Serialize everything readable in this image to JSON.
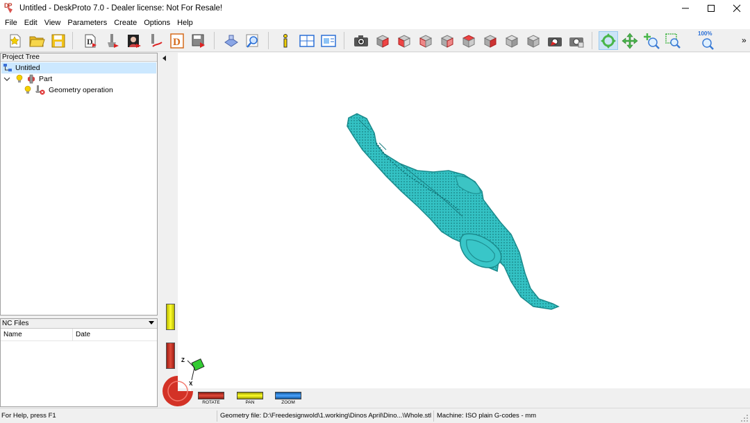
{
  "window": {
    "title": "Untitled - DeskProto 7.0 - Dealer license: Not For Resale!"
  },
  "menu": [
    "File",
    "Edit",
    "View",
    "Parameters",
    "Create",
    "Options",
    "Help"
  ],
  "toolbar": {
    "zoom_percent_label": "100%",
    "overflow_label": "»",
    "buttons": [
      "new-project-icon",
      "open-project-icon",
      "save-project-icon",
      "part-parameters-icon",
      "operation-wizard-icon",
      "bitmap-icon",
      "vector-icon",
      "dxf-icon",
      "save-nc-icon",
      "simulation-icon",
      "preview-icon",
      "info-icon",
      "layout-icon",
      "viewports-icon",
      "snapshot-icon",
      "view-front-icon",
      "view-back-icon",
      "view-left-icon",
      "view-right-icon",
      "view-top-icon",
      "view-bottom-icon",
      "view-iso-icon",
      "view-iso2-icon",
      "capture-icon",
      "capture2-icon",
      "rotate-tool-icon",
      "pan-tool-icon",
      "zoom-tool-icon",
      "zoom-window-icon",
      "zoom-100-icon"
    ],
    "active_button": "rotate-tool-icon"
  },
  "project_tree": {
    "header": "Project Tree",
    "items": [
      {
        "label": "Untitled",
        "level": 0,
        "selected": true
      },
      {
        "label": "Part",
        "level": 1,
        "expanded": true
      },
      {
        "label": "Geometry operation",
        "level": 2
      }
    ]
  },
  "nc_files": {
    "header": "NC Files",
    "columns": [
      "Name",
      "Date"
    ],
    "rows": []
  },
  "viewport": {
    "model_color": "#3cc4c4",
    "background": "#ffffff",
    "axis_labels": {
      "z": "Z",
      "x": "X"
    }
  },
  "view_controls": {
    "rotate_label": "ROTATE",
    "pan_label": "PAN",
    "zoom_label": "ZOOM",
    "colors": {
      "rotate": "#c8352a",
      "pan": "#e8e81a",
      "zoom": "#2a7de1"
    }
  },
  "status": {
    "help": "For Help, press F1",
    "geometry_file": "Geometry file: D:\\Freedesignwold\\1.working\\Dinos April\\Dino...\\Whole.stl",
    "machine": "Machine: ISO plain G-codes - mm"
  }
}
